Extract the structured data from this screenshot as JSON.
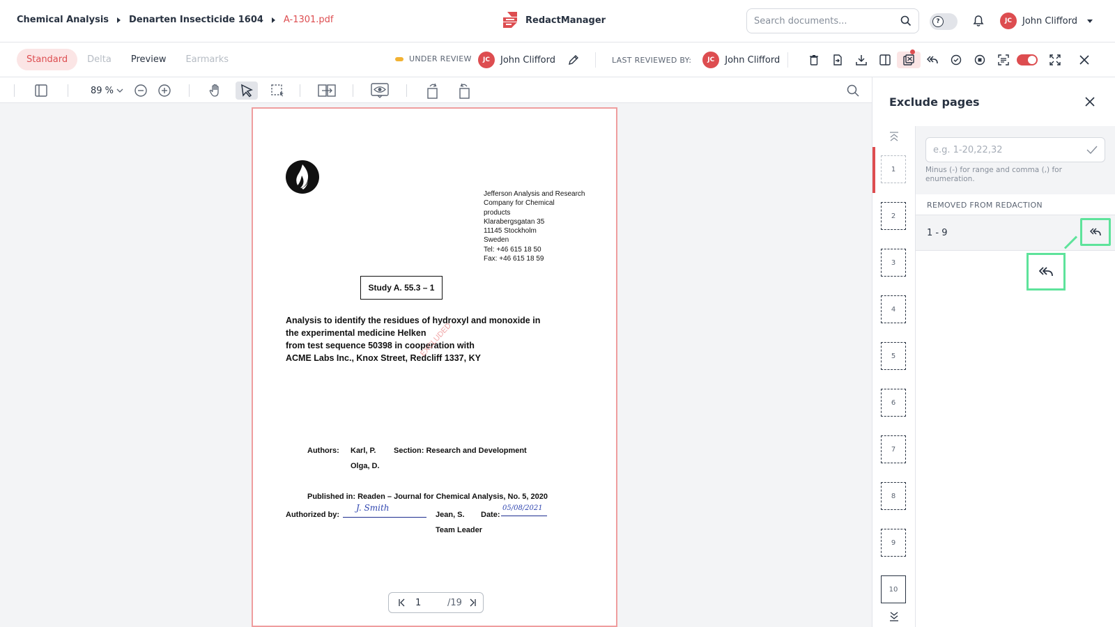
{
  "breadcrumb": {
    "items": [
      "Chemical Analysis",
      "Denarten Insecticide 1604"
    ],
    "current": "A-1301.pdf"
  },
  "brand": {
    "name": "RedactManager",
    "accent": "#dd4d50"
  },
  "search": {
    "placeholder": "Search documents..."
  },
  "user": {
    "initials": "JC",
    "name": "John Clifford"
  },
  "view_modes": [
    {
      "label": "Standard",
      "state": "active"
    },
    {
      "label": "Delta",
      "state": "disabled"
    },
    {
      "label": "Preview",
      "state": "normal"
    },
    {
      "label": "Earmarks",
      "state": "disabled"
    }
  ],
  "status": {
    "label": "UNDER REVIEW",
    "color": "#f2b233"
  },
  "assignee": {
    "initials": "JC",
    "name": "John Clifford"
  },
  "last_reviewed": {
    "label": "LAST REVIEWED BY:",
    "initials": "JC",
    "name": "John Clifford"
  },
  "toolbar": {
    "zoom": "89 %"
  },
  "document": {
    "address_lines": [
      "Jefferson Analysis and Research",
      "Company for Chemical",
      "products",
      "Klarabergsgatan 35",
      "11145 Stockholm",
      "Sweden",
      "Tel: +46 615 18 50",
      "Fax: +46 615 18 59"
    ],
    "study": "Study A. 55.3 – 1",
    "title_lines": [
      "Analysis to identify the residues of hydroxyl and monoxide in",
      "the experimental medicine Helken",
      "from test sequence 50398 in cooperation with",
      "ACME Labs Inc., Knox Street, Redcliff 1337, KY"
    ],
    "stamp": "EXCLUDED",
    "authors_label": "Authors:",
    "author_1": "Karl, P.",
    "author_2": "Olga, D.",
    "section": "Section: Research and Development",
    "published": "Published in: Readen – Journal for Chemical Analysis, No. 5, 2020",
    "authorized_label": "Authorized by:",
    "signature": "J. Smith",
    "signer": "Jean, S.",
    "signer_role": "Team Leader",
    "date_label": "Date:",
    "date_value": "05/08/2021"
  },
  "pager": {
    "current": "1",
    "total": "/19"
  },
  "panel": {
    "title": "Exclude pages",
    "input_placeholder": "e.g. 1-20,22,32",
    "hint": "Minus (-) for range and comma (,) for enumeration.",
    "section_header": "REMOVED FROM REDACTION",
    "ranges": [
      {
        "text": "1 - 9"
      }
    ],
    "thumbnails": [
      "1",
      "2",
      "3",
      "4",
      "5",
      "6",
      "7",
      "8",
      "9",
      "10"
    ]
  }
}
